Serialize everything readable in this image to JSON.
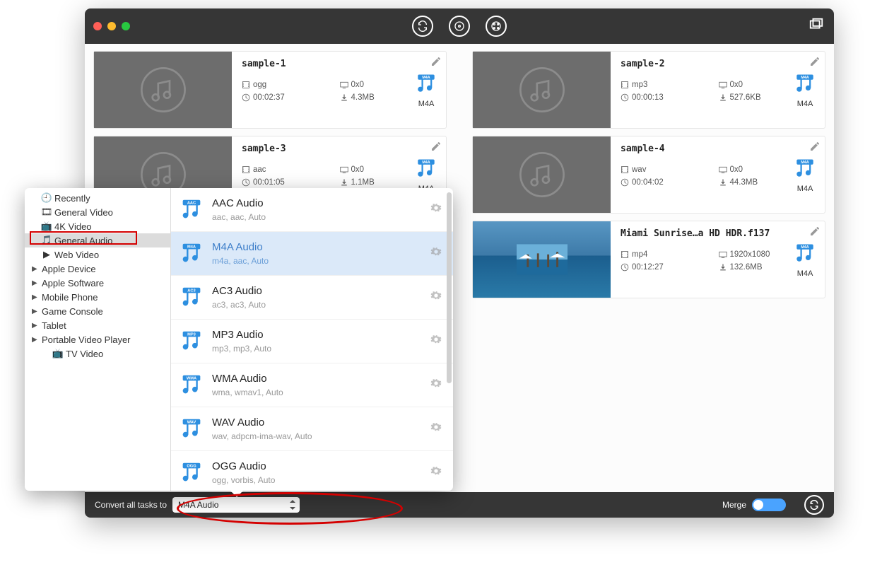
{
  "titlebar": {
    "close": "close",
    "min": "min",
    "max": "max"
  },
  "cards": [
    {
      "title": "sample-1",
      "format": "ogg",
      "res": "0x0",
      "dur": "00:02:37",
      "size": "4.3MB",
      "target": "M4A",
      "thumb": "audio"
    },
    {
      "title": "sample-2",
      "format": "mp3",
      "res": "0x0",
      "dur": "00:00:13",
      "size": "527.6KB",
      "target": "M4A",
      "thumb": "audio"
    },
    {
      "title": "sample-3",
      "format": "aac",
      "res": "0x0",
      "dur": "00:01:05",
      "size": "1.1MB",
      "target": "M4A",
      "thumb": "audio"
    },
    {
      "title": "sample-4",
      "format": "wav",
      "res": "0x0",
      "dur": "00:04:02",
      "size": "44.3MB",
      "target": "M4A",
      "thumb": "audio"
    },
    {
      "title": "Miami Sunrise…a HD HDR.f137",
      "format": "mp4",
      "res": "1920x1080",
      "dur": "00:12:27",
      "size": "132.6MB",
      "target": "M4A",
      "thumb": "video"
    }
  ],
  "bottom": {
    "label": "Convert all tasks to",
    "value": "M4A Audio",
    "merge": "Merge"
  },
  "sidebar": [
    {
      "label": "Recently",
      "icon": "clock"
    },
    {
      "label": "General Video",
      "icon": "video"
    },
    {
      "label": "4K Video",
      "icon": "4k"
    },
    {
      "label": "General Audio",
      "icon": "audio",
      "selected": true
    },
    {
      "label": "Web Video",
      "icon": "youtube"
    },
    {
      "label": "Apple Device",
      "expandable": true
    },
    {
      "label": "Apple Software",
      "expandable": true
    },
    {
      "label": "Mobile Phone",
      "expandable": true
    },
    {
      "label": "Game Console",
      "expandable": true
    },
    {
      "label": "Tablet",
      "expandable": true
    },
    {
      "label": "Portable Video Player",
      "expandable": true
    },
    {
      "label": "TV Video",
      "icon": "tv"
    }
  ],
  "formats": [
    {
      "name": "AAC Audio",
      "sub": "aac,    aac,    Auto",
      "tag": "AAC"
    },
    {
      "name": "M4A Audio",
      "sub": "m4a,    aac,    Auto",
      "tag": "M4A",
      "selected": true
    },
    {
      "name": "AC3 Audio",
      "sub": "ac3,    ac3,    Auto",
      "tag": "AC3"
    },
    {
      "name": "MP3 Audio",
      "sub": "mp3,    mp3,    Auto",
      "tag": "MP3"
    },
    {
      "name": "WMA Audio",
      "sub": "wma,    wmav1,    Auto",
      "tag": "WMA"
    },
    {
      "name": "WAV Audio",
      "sub": "wav,    adpcm-ima-wav,    Auto",
      "tag": "WAV"
    },
    {
      "name": "OGG Audio",
      "sub": "ogg,    vorbis,    Auto",
      "tag": "OGG"
    }
  ]
}
